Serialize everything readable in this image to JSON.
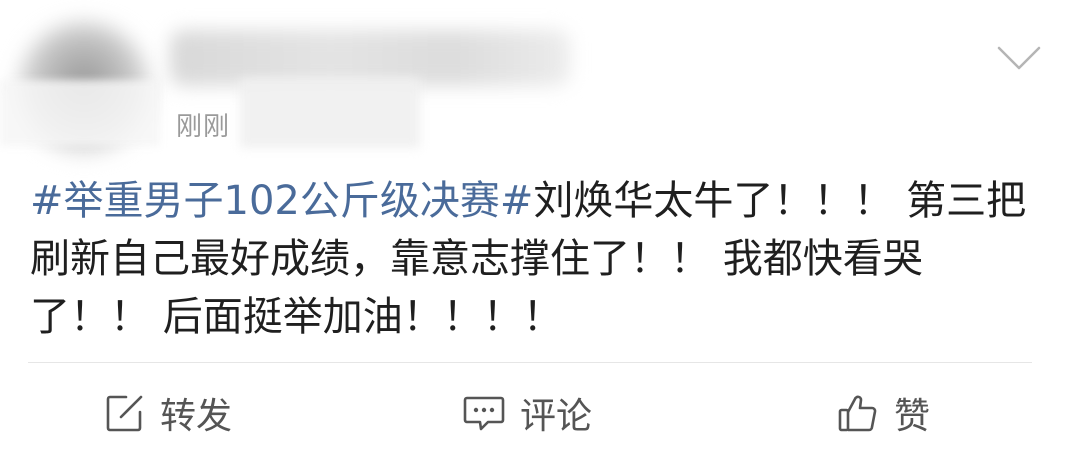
{
  "header": {
    "timestamp": "刚刚",
    "menu_icon": "chevron-down-icon"
  },
  "post": {
    "topic": "#举重男子102公斤级决赛#",
    "text": "刘焕华太牛了！！！ 第三把刷新自己最好成绩，靠意志撑住了！！ 我都快看哭了！！ 后面挺举加油！！！！"
  },
  "actions": {
    "repost": {
      "label": "转发",
      "icon": "edit-share-icon"
    },
    "comment": {
      "label": "评论",
      "icon": "comment-icon"
    },
    "like": {
      "label": "赞",
      "icon": "thumbs-up-icon"
    }
  },
  "colors": {
    "topic": "#4a6b9a",
    "text": "#1f1f1f",
    "muted": "#9a9a9a",
    "action": "#555555",
    "divider": "#e6e6e6"
  }
}
